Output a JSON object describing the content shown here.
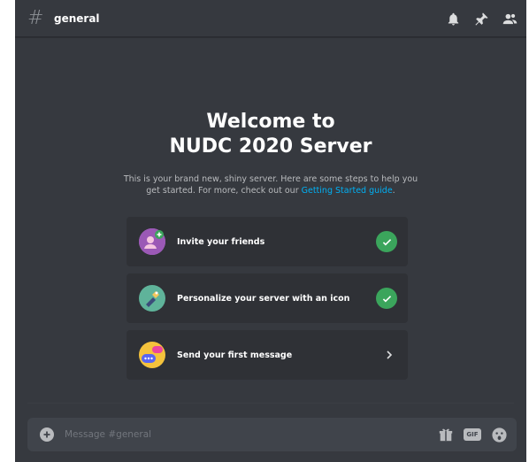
{
  "header": {
    "channel_name": "general",
    "icons": [
      "bell-icon",
      "pin-icon",
      "members-icon"
    ]
  },
  "welcome": {
    "title_line1": "Welcome to",
    "title_line2": "NUDC 2020 Server",
    "subtitle_text": "This is your brand new, shiny server. Here are some steps to help you get started. For more, check out our ",
    "subtitle_link": "Getting Started guide",
    "subtitle_end": "."
  },
  "steps": [
    {
      "label": "Invite your friends",
      "status": "complete",
      "icon": "invite-friends-icon"
    },
    {
      "label": "Personalize your server with an icon",
      "status": "complete",
      "icon": "personalize-icon"
    },
    {
      "label": "Send your first message",
      "status": "pending",
      "icon": "message-icon"
    }
  ],
  "composer": {
    "placeholder": "Message #general",
    "value": "",
    "icons": [
      "gift-icon",
      "gif-icon",
      "emoji-icon"
    ],
    "gif_label": "GIF"
  },
  "colors": {
    "background": "#36393f",
    "card": "#2f3136",
    "input": "#40444b",
    "success": "#3ba55c",
    "link": "#00b0f4"
  }
}
